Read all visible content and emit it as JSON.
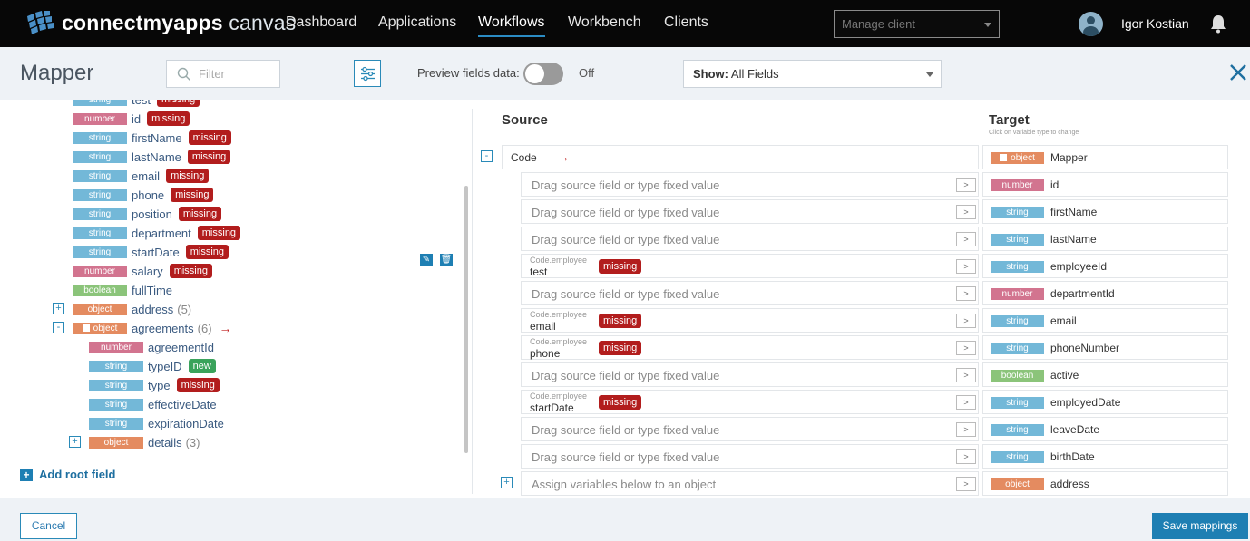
{
  "brand": {
    "name_bold": "connectmyapps",
    "name_thin": " canvas"
  },
  "nav": [
    "Dashboard",
    "Applications",
    "Workflows",
    "Workbench",
    "Clients"
  ],
  "nav_active": "Workflows",
  "manage_client": {
    "placeholder": "Manage client"
  },
  "user": {
    "name": "Igor Kostian"
  },
  "mapper": {
    "title": "Mapper",
    "filter_placeholder": "Filter",
    "preview_label": "Preview fields data:",
    "preview_state": "Off",
    "show_label": "Show:",
    "show_value": " All Fields"
  },
  "tree": {
    "rows": [
      {
        "type": "string",
        "name": "test",
        "badge": "missing"
      },
      {
        "type": "number",
        "name": "id",
        "badge": "missing"
      },
      {
        "type": "string",
        "name": "firstName",
        "badge": "missing"
      },
      {
        "type": "string",
        "name": "lastName",
        "badge": "missing"
      },
      {
        "type": "string",
        "name": "email",
        "badge": "missing"
      },
      {
        "type": "string",
        "name": "phone",
        "badge": "missing"
      },
      {
        "type": "string",
        "name": "position",
        "badge": "missing"
      },
      {
        "type": "string",
        "name": "department",
        "badge": "missing"
      },
      {
        "type": "string",
        "name": "startDate",
        "badge": "missing"
      },
      {
        "type": "number",
        "name": "salary",
        "badge": "missing"
      },
      {
        "type": "boolean",
        "name": "fullTime",
        "badge": ""
      },
      {
        "type": "object",
        "name": "address",
        "count": "(5)",
        "expander": "+"
      },
      {
        "type": "object",
        "name": "agreements",
        "count": "(6)",
        "expander": "-"
      },
      {
        "type": "number",
        "name": "agreementId",
        "badge": ""
      },
      {
        "type": "string",
        "name": "typeID",
        "badge": "new"
      },
      {
        "type": "string",
        "name": "type",
        "badge": "missing"
      },
      {
        "type": "string",
        "name": "effectiveDate",
        "badge": ""
      },
      {
        "type": "string",
        "name": "expirationDate",
        "badge": ""
      },
      {
        "type": "object",
        "name": "details",
        "count": "(3)",
        "expander": "+"
      }
    ],
    "add_root": "Add root field"
  },
  "source_header": "Source",
  "target_header": "Target",
  "target_sub": "Click on variable type to change",
  "code_row": {
    "label": "Code",
    "expander": "-"
  },
  "mappings": [
    {
      "placeholder": "Drag source field or type fixed value",
      "ttype": "object",
      "tname": "Mapper",
      "root": true
    },
    {
      "placeholder": "Drag source field or type fixed value",
      "ttype": "number",
      "tname": "id"
    },
    {
      "placeholder": "Drag source field or type fixed value",
      "ttype": "string",
      "tname": "firstName"
    },
    {
      "placeholder": "Drag source field or type fixed value",
      "ttype": "string",
      "tname": "lastName"
    },
    {
      "path": "Code.employee",
      "field": "test",
      "badge": "missing",
      "ttype": "string",
      "tname": "employeeId"
    },
    {
      "placeholder": "Drag source field or type fixed value",
      "ttype": "number",
      "tname": "departmentId"
    },
    {
      "path": "Code.employee",
      "field": "email",
      "badge": "missing",
      "ttype": "string",
      "tname": "email"
    },
    {
      "path": "Code.employee",
      "field": "phone",
      "badge": "missing",
      "ttype": "string",
      "tname": "phoneNumber"
    },
    {
      "placeholder": "Drag source field or type fixed value",
      "ttype": "boolean",
      "tname": "active"
    },
    {
      "path": "Code.employee",
      "field": "startDate",
      "badge": "missing",
      "ttype": "string",
      "tname": "employedDate"
    },
    {
      "placeholder": "Drag source field or type fixed value",
      "ttype": "string",
      "tname": "leaveDate"
    },
    {
      "placeholder": "Drag source field or type fixed value",
      "ttype": "string",
      "tname": "birthDate"
    },
    {
      "placeholder": "Assign variables below to an object",
      "ttype": "object",
      "tname": "address",
      "expander": "+"
    }
  ],
  "arrow_symbol": "→",
  "gt_symbol": ">",
  "footer": {
    "cancel": "Cancel",
    "save": "Save mappings"
  },
  "colors": {
    "accent": "#1e7fb3",
    "missing": "#b21d1d",
    "new": "#3aa35b",
    "string": "#73b8d8",
    "number": "#d2748f",
    "boolean": "#8bc47a",
    "object": "#e48b60"
  }
}
